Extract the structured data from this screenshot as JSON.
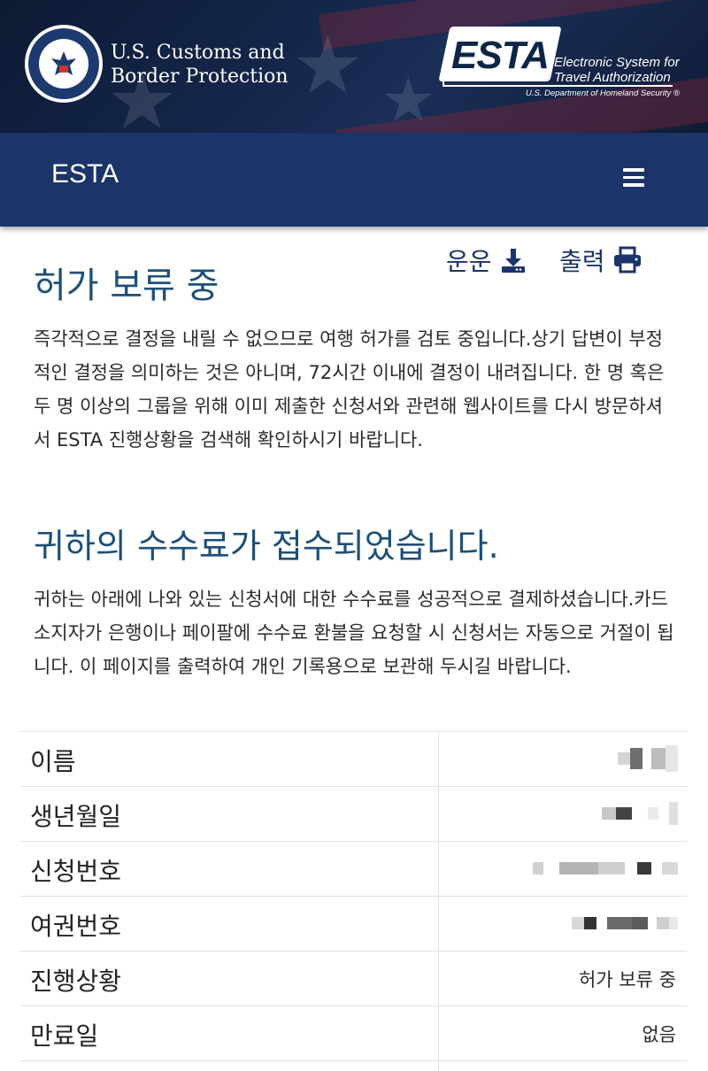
{
  "header": {
    "agency_line1": "U.S. Customs and",
    "agency_line2": "Border Protection",
    "seal_icon": "dhs-seal-icon",
    "esta_logo_word": "ESTA",
    "esta_tagline_1": "Electronic System for",
    "esta_tagline_2": "Travel Authorization",
    "esta_dhs": "U.S. Department of Homeland Security ®"
  },
  "nav": {
    "title": "ESTA",
    "menu_icon": "hamburger-menu-icon"
  },
  "toolbar": {
    "download_label": "운운",
    "download_icon": "download-icon",
    "print_label": "출력",
    "print_icon": "printer-icon"
  },
  "status_section": {
    "heading": "허가 보류 중",
    "body": "즉각적으로 결정을 내릴 수 없으므로 여행 허가를 검토 중입니다.상기 답변이 부정적인 결정을 의미하는 것은 아니며, 72시간 이내에 결정이 내려집니다. 한 명 혹은 두 명 이상의 그룹을 위해 이미 제출한 신청서와 관련해 웹사이트를 다시 방문하셔서 ESTA 진행상황을 검색해 확인하시기 바랍니다."
  },
  "fee_section": {
    "heading": "귀하의 수수료가 접수되었습니다.",
    "body": "귀하는 아래에 나와 있는 신청서에 대한 수수료를 성공적으로 결제하셨습니다.카드 소지자가 은행이나 페이팔에 수수료 환불을 요청할 시 신청서는 자동으로 거절이 됩니다. 이 페이지를 출력하여 개인 기록용으로 보관해 두시길 바랍니다."
  },
  "details": {
    "rows": [
      {
        "label": "이름",
        "value": ""
      },
      {
        "label": "생년월일",
        "value": ""
      },
      {
        "label": "신청번호",
        "value": ""
      },
      {
        "label": "여권번호",
        "value": ""
      },
      {
        "label": "진행상황",
        "value": "허가 보류 중"
      },
      {
        "label": "만료일",
        "value": "없음"
      }
    ]
  },
  "colors": {
    "nav_bg": "#1b3469",
    "heading": "#1d4f78",
    "banner_bg": "#14264a"
  }
}
